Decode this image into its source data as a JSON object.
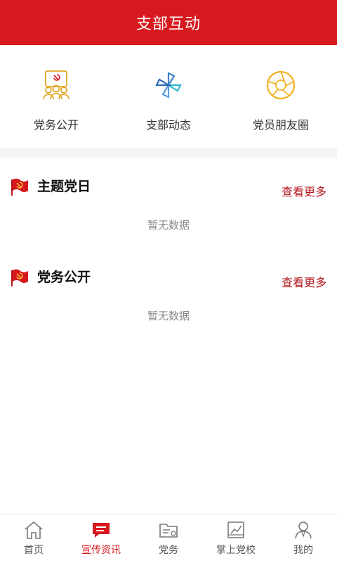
{
  "header": {
    "title": "支部互动"
  },
  "quick_links": [
    {
      "label": "党务公开",
      "icon": "party-meeting-icon",
      "color": "#e3a826"
    },
    {
      "label": "支部动态",
      "icon": "pinwheel-icon",
      "color": "#3d7fc9"
    },
    {
      "label": "党员朋友圈",
      "icon": "aperture-circle-icon",
      "color": "#f0b322"
    }
  ],
  "sections": [
    {
      "title": "主题党日",
      "more": "查看更多",
      "empty": "暂无数据"
    },
    {
      "title": "党务公开",
      "more": "查看更多",
      "empty": "暂无数据"
    }
  ],
  "tabbar": {
    "active_color": "#d7191f",
    "items": [
      {
        "label": "首页",
        "icon": "home-icon",
        "active": false
      },
      {
        "label": "宣传资讯",
        "icon": "message-icon",
        "active": true
      },
      {
        "label": "党务",
        "icon": "folder-icon",
        "active": false
      },
      {
        "label": "掌上党校",
        "icon": "book-chart-icon",
        "active": false
      },
      {
        "label": "我的",
        "icon": "user-icon",
        "active": false
      }
    ]
  },
  "colors": {
    "brand": "#d7191f",
    "more_link": "#b3151b"
  }
}
